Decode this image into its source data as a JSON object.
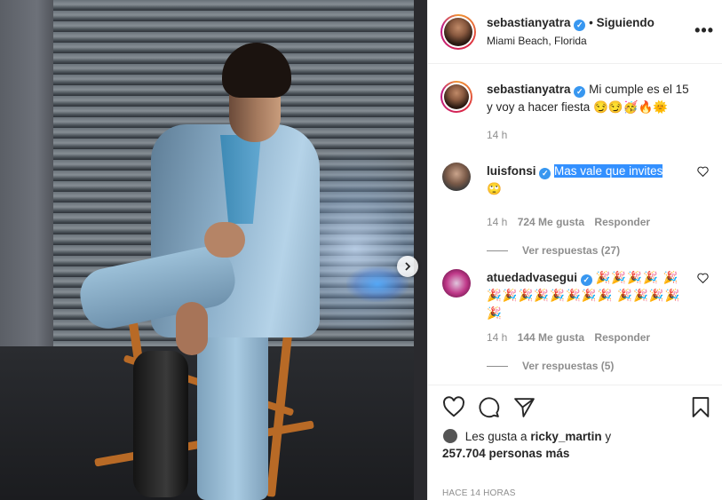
{
  "post": {
    "username": "sebastianyatra",
    "follow_status": "Siguiendo",
    "separator": "•",
    "location": "Miami Beach, Florida",
    "more": "•••"
  },
  "caption": {
    "username": "sebastianyatra",
    "text": "Mi cumple es el 15 y voy a hacer fiesta 😏😏🥳🔥🌞",
    "time": "14 h"
  },
  "comments": [
    {
      "username": "luisfonsi",
      "text": "Mas vale que invites",
      "emoji": "🙄",
      "time": "14 h",
      "likes": "724 Me gusta",
      "reply": "Responder",
      "view_replies": "Ver respuestas (27)"
    },
    {
      "username": "atuedadvasegui",
      "text": "🎉🎉🎉🎉 🎉🎉🎉🎉🎉🎉🎉🎉🎉 🎉🎉🎉🎉🎉",
      "time": "14 h",
      "likes": "144 Me gusta",
      "reply": "Responder",
      "view_replies": "Ver respuestas (5)"
    }
  ],
  "likes": {
    "prefix": "Les gusta a",
    "user": "ricky_martin",
    "conj": "y",
    "count": "257.704 personas más"
  },
  "timestamp": "HACE 14 HORAS",
  "verified_mark": "✓",
  "icons": {
    "like": "heart-icon",
    "comment": "comment-icon",
    "share": "share-icon",
    "save": "bookmark-icon",
    "next": "chevron-right-icon"
  },
  "colors": {
    "verified": "#3897f0",
    "muted": "#8e8e8e",
    "text": "#262626",
    "highlight": "#3390ff"
  }
}
